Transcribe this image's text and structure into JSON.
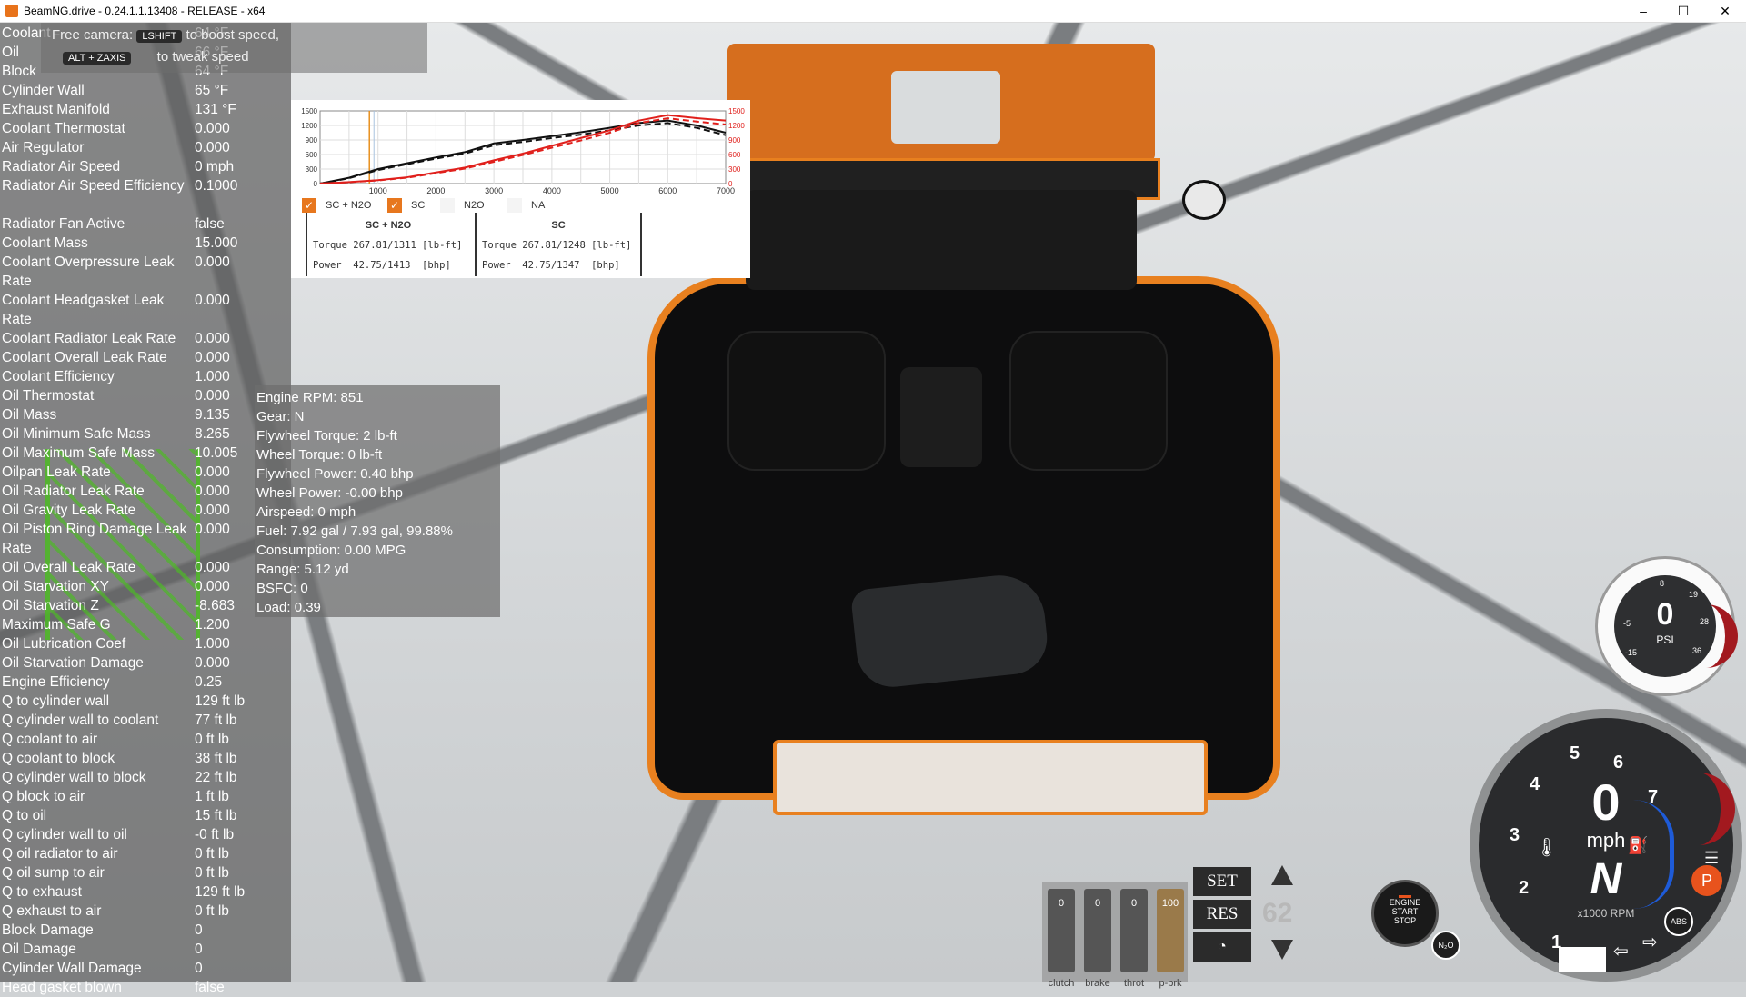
{
  "window": {
    "title": "BeamNG.drive - 0.24.1.1.13408 - RELEASE - x64",
    "minimize": "–",
    "maximize": "☐",
    "close": "✕"
  },
  "free_camera": {
    "label": "Free camera:",
    "key1": "LSHIFT",
    "hint1": "to boost speed,",
    "key2": "ALT + ZAXIS",
    "hint2": "to tweak speed"
  },
  "thermal_rows": [
    {
      "label": "Coolant",
      "value": "64 °F"
    },
    {
      "label": "Oil",
      "value": "66 °F"
    },
    {
      "label": "Block",
      "value": "64 °F"
    },
    {
      "label": "Cylinder Wall",
      "value": "65 °F"
    },
    {
      "label": "Exhaust Manifold",
      "value": "131 °F"
    },
    {
      "label": "Coolant Thermostat",
      "value": "0.000"
    },
    {
      "label": "Air Regulator",
      "value": "0.000"
    },
    {
      "label": "Radiator Air Speed",
      "value": "0 mph"
    },
    {
      "label": "Radiator Air Speed Efficiency",
      "value": "0.1000"
    },
    {
      "label": "Radiator Fan Active",
      "value": "false"
    },
    {
      "label": "Coolant Mass",
      "value": "15.000"
    },
    {
      "label": "Coolant Overpressure Leak Rate",
      "value": "0.000"
    },
    {
      "label": "Coolant Headgasket Leak Rate",
      "value": "0.000"
    },
    {
      "label": "Coolant Radiator Leak Rate",
      "value": "0.000"
    },
    {
      "label": "Coolant Overall Leak Rate",
      "value": "0.000"
    },
    {
      "label": "Coolant Efficiency",
      "value": "1.000"
    },
    {
      "label": "Oil Thermostat",
      "value": "0.000"
    },
    {
      "label": "Oil Mass",
      "value": "9.135"
    },
    {
      "label": "Oil Minimum Safe Mass",
      "value": "8.265"
    },
    {
      "label": "Oil Maximum Safe Mass",
      "value": "10.005"
    },
    {
      "label": "Oilpan Leak Rate",
      "value": "0.000"
    },
    {
      "label": "Oil Radiator Leak Rate",
      "value": "0.000"
    },
    {
      "label": "Oil Gravity Leak Rate",
      "value": "0.000"
    },
    {
      "label": "Oil Piston Ring Damage Leak Rate",
      "value": "0.000"
    },
    {
      "label": "Oil Overall Leak Rate",
      "value": "0.000"
    },
    {
      "label": "Oil Starvation XY",
      "value": "0.000"
    },
    {
      "label": "Oil Starvation Z",
      "value": "-8.683"
    },
    {
      "label": "Maximum Safe G",
      "value": "1.200"
    },
    {
      "label": "Oil Lubrication Coef",
      "value": "1.000"
    },
    {
      "label": "Oil Starvation Damage",
      "value": "0.000"
    },
    {
      "label": "Engine Efficiency",
      "value": "0.25"
    },
    {
      "label": "Q to cylinder wall",
      "value": "129 ft lb"
    },
    {
      "label": "Q cylinder wall to coolant",
      "value": "77 ft lb"
    },
    {
      "label": "Q coolant to air",
      "value": "0 ft lb"
    },
    {
      "label": "Q coolant to block",
      "value": "38 ft lb"
    },
    {
      "label": "Q cylinder wall to block",
      "value": "22 ft lb"
    },
    {
      "label": "Q block to air",
      "value": "1 ft lb"
    },
    {
      "label": "Q to oil",
      "value": "15 ft lb"
    },
    {
      "label": "Q cylinder wall to oil",
      "value": "-0 ft lb"
    },
    {
      "label": "Q oil radiator to air",
      "value": "0 ft lb"
    },
    {
      "label": "Q oil sump to air",
      "value": "0 ft lb"
    },
    {
      "label": "Q to exhaust",
      "value": "129 ft lb"
    },
    {
      "label": "Q exhaust to air",
      "value": "0 ft lb"
    },
    {
      "label": "Block Damage",
      "value": "0"
    },
    {
      "label": "Oil Damage",
      "value": "0"
    },
    {
      "label": "Cylinder Wall Damage",
      "value": "0"
    },
    {
      "label": "Head gasket blown",
      "value": "false"
    }
  ],
  "engine_info": [
    "Engine RPM: 851",
    "Gear: N",
    "Flywheel Torque: 2 lb-ft",
    "Wheel Torque: 0 lb-ft",
    "Flywheel Power: 0.40 bhp",
    "Wheel Power: -0.00 bhp",
    "Airspeed: 0 mph",
    "Fuel: 7.92 gal / 7.93 gal, 99.88%",
    "Consumption: 0.00 MPG",
    "Range: 5.12 yd",
    "BSFC: 0",
    "Load: 0.39"
  ],
  "torque_graph": {
    "legend": [
      {
        "label": "SC + N2O",
        "checked": true
      },
      {
        "label": "SC",
        "checked": true
      },
      {
        "label": "N2O",
        "checked": false
      },
      {
        "label": "NA",
        "checked": false
      }
    ],
    "panels": [
      {
        "title": "SC + N2O",
        "torque": "Torque 267.81/1311 [lb-ft]",
        "power": "Power  42.75/1413  [bhp]"
      },
      {
        "title": "SC",
        "torque": "Torque 267.81/1248 [lb-ft]",
        "power": "Power  42.75/1347  [bhp]"
      }
    ],
    "colors": {
      "torque": "#111111",
      "power": "#e0201c",
      "cursor": "#e8901e"
    }
  },
  "chart_data": {
    "type": "line",
    "x": [
      0,
      500,
      1000,
      1500,
      2000,
      2500,
      3000,
      3500,
      4000,
      4500,
      5000,
      5500,
      6000,
      6500,
      7000
    ],
    "xlim": [
      0,
      7000
    ],
    "x_ticks": [
      "1000",
      "2000",
      "3000",
      "4000",
      "5000",
      "6000",
      "7000"
    ],
    "y_left_ticks": [
      "0",
      "300",
      "600",
      "900",
      "1200",
      "1500"
    ],
    "y_right_ticks": [
      "0",
      "300",
      "600",
      "900",
      "1200",
      "1500"
    ],
    "ylim": [
      0,
      1500
    ],
    "cursor_rpm": 851,
    "series": [
      {
        "key": "sc_n2o_torque",
        "color": "#111111",
        "dash": false,
        "values": [
          0,
          120,
          300,
          420,
          540,
          650,
          830,
          900,
          980,
          1060,
          1150,
          1250,
          1300,
          1200,
          1050
        ]
      },
      {
        "key": "sc_torque",
        "color": "#111111",
        "dash": true,
        "values": [
          0,
          110,
          280,
          400,
          515,
          620,
          790,
          860,
          940,
          1010,
          1100,
          1200,
          1248,
          1150,
          1000
        ]
      },
      {
        "key": "sc_n2o_power",
        "color": "#e0201c",
        "dash": false,
        "values": [
          0,
          30,
          70,
          130,
          230,
          330,
          480,
          620,
          780,
          940,
          1100,
          1300,
          1413,
          1350,
          1300
        ]
      },
      {
        "key": "sc_power",
        "color": "#e0201c",
        "dash": true,
        "values": [
          0,
          28,
          65,
          120,
          215,
          310,
          450,
          590,
          740,
          890,
          1050,
          1250,
          1347,
          1280,
          1220
        ]
      }
    ]
  },
  "boost_gauge": {
    "value": "0",
    "unit": "PSI",
    "ticks": [
      "-15",
      "-5",
      "8",
      "19",
      "28",
      "36"
    ]
  },
  "speedo": {
    "speed": "0",
    "unit": "mph",
    "gear": "N",
    "rpm_unit": "x1000 RPM",
    "ticks": [
      "1",
      "2",
      "3",
      "4",
      "5",
      "6",
      "7"
    ],
    "parking": "P",
    "abs": "ABS"
  },
  "pedals": [
    {
      "name": "clutch",
      "value": "0"
    },
    {
      "name": "brake",
      "value": "0"
    },
    {
      "name": "throt",
      "value": "0"
    },
    {
      "name": "p-brk",
      "value": "100"
    }
  ],
  "cruise": {
    "set": "SET",
    "res": "RES",
    "speed": "62"
  },
  "engine_button": {
    "line1": "ENGINE",
    "line2": "START",
    "line3": "STOP"
  },
  "n2o_label": "N₂O"
}
